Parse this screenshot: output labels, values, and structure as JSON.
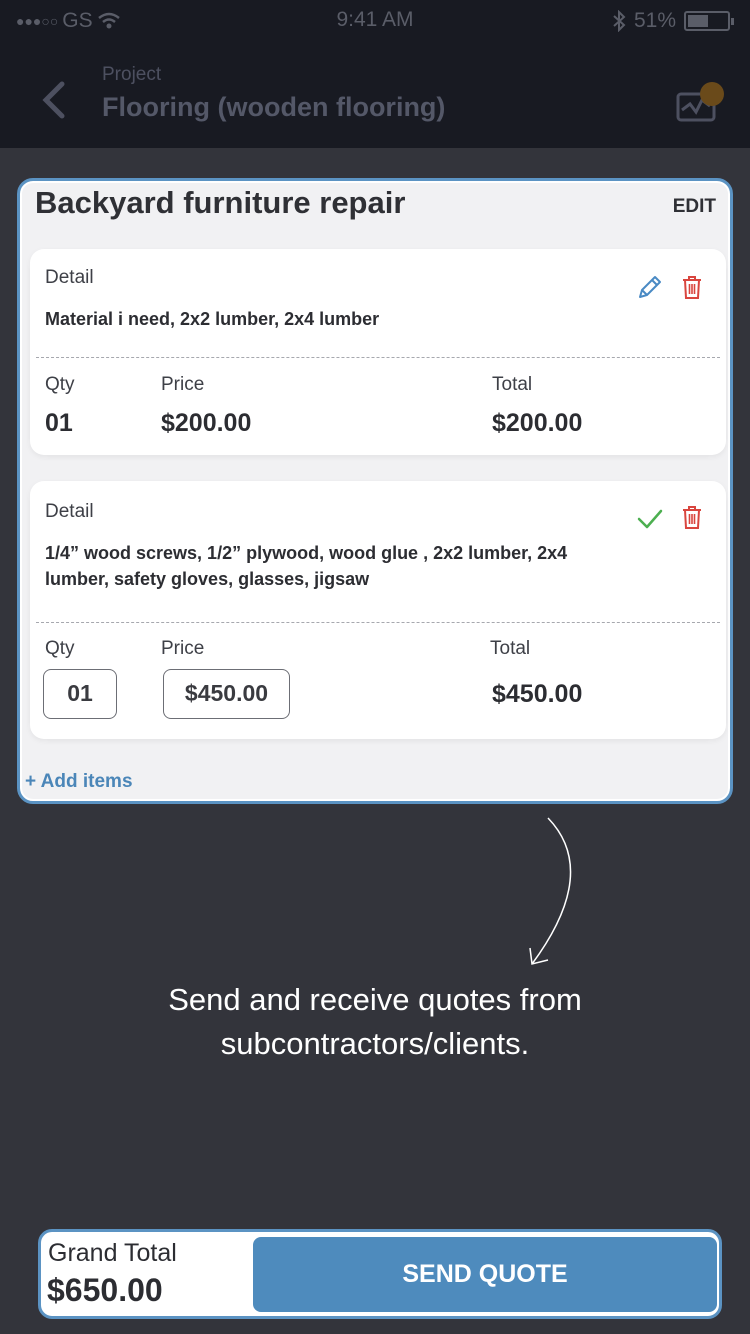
{
  "status_bar": {
    "carrier": "GS",
    "time": "9:41 AM",
    "battery": "51%"
  },
  "nav": {
    "subtitle": "Project",
    "title": "Flooring (wooden flooring)"
  },
  "card": {
    "title": "Backyard furniture repair",
    "edit_label": "EDIT",
    "items": [
      {
        "detail_label": "Detail",
        "detail": "Material i need, 2x2 lumber, 2x4 lumber",
        "qty_label": "Qty",
        "price_label": "Price",
        "total_label": "Total",
        "qty": "01",
        "price": "$200.00",
        "total": "$200.00"
      },
      {
        "detail_label": "Detail",
        "detail": "1/4” wood screws, 1/2” plywood, wood glue , 2x2 lumber, 2x4 lumber, safety gloves, glasses, jigsaw",
        "qty_label": "Qty",
        "price_label": "Price",
        "total_label": "Total",
        "qty": "01",
        "price": "$450.00",
        "total": "$450.00"
      }
    ],
    "add_items_label": "+ Add items"
  },
  "caption": {
    "line1": "Send and receive quotes from",
    "line2": "subcontractors/clients."
  },
  "bottom": {
    "grand_total_label": "Grand Total",
    "grand_total": "$650.00",
    "send_label": "SEND QUOTE"
  },
  "colors": {
    "accent": "#4e8bbd",
    "background": "#33343b",
    "delete": "#d9453e",
    "confirm": "#4caf50"
  }
}
